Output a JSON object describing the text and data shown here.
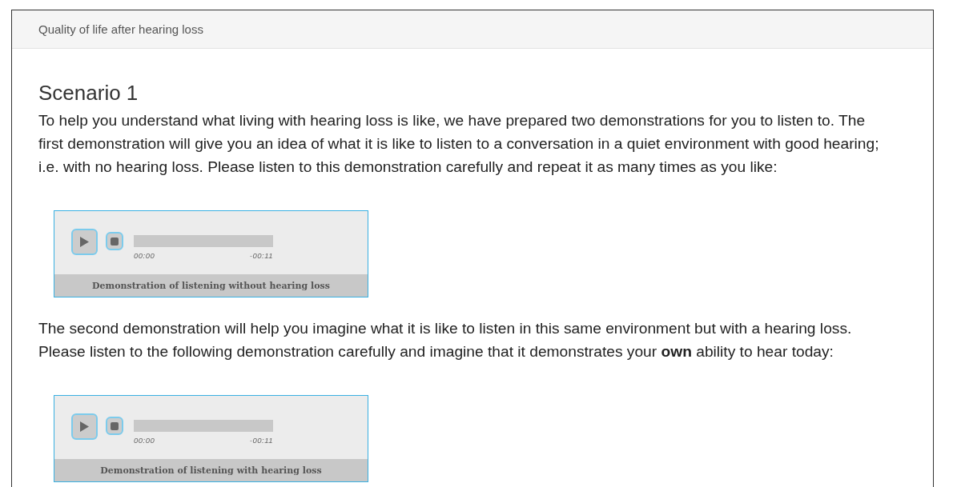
{
  "panel": {
    "title": "Quality of life after hearing loss"
  },
  "heading": "Scenario 1",
  "sections": [
    {
      "text": "To help you understand what living with hearing loss is like, we have prepared two demonstrations for you to listen to. The first demonstration will give you an idea of what it is like to listen to a conversation in a quiet environment with good hearing; i.e. with no hearing loss. Please listen to this demonstration carefully and repeat it as many times as you like:",
      "player": {
        "elapsed": "00:00",
        "remaining": "-00:11",
        "caption": "Demonstration of listening without hearing loss"
      }
    },
    {
      "text": "The second demonstration will help you imagine what it is like to listen in this same environment but with a hearing loss. Please listen to the following demonstration carefully and imagine that it demonstrates your **own** ability to hear today:",
      "player": {
        "elapsed": "00:00",
        "remaining": "-00:11",
        "caption": "Demonstration of listening with hearing loss"
      }
    }
  ]
}
